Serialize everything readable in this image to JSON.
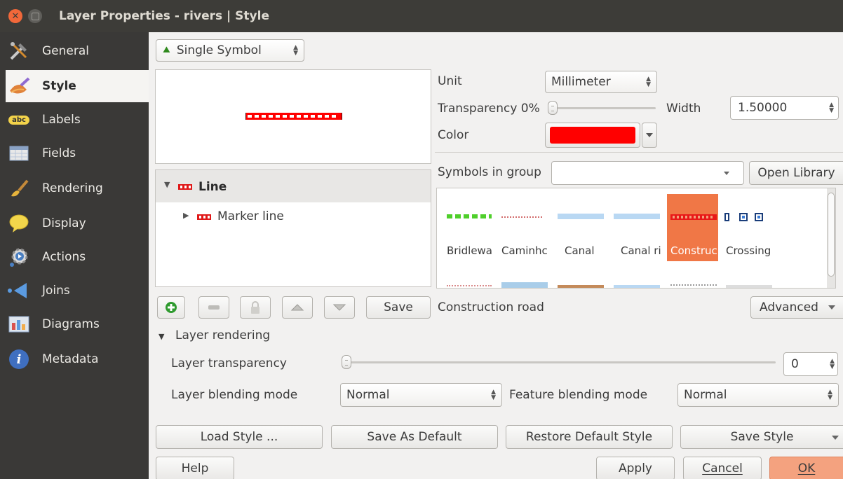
{
  "window": {
    "title": "Layer Properties - rivers | Style",
    "close_glyph": "✕"
  },
  "sidebar": {
    "items": [
      {
        "label": "General",
        "icon": "tools-icon"
      },
      {
        "label": "Style",
        "icon": "brush-icon"
      },
      {
        "label": "Labels",
        "icon": "abc-label-icon",
        "icon_text": "abc"
      },
      {
        "label": "Fields",
        "icon": "table-icon"
      },
      {
        "label": "Rendering",
        "icon": "paintbrush-icon"
      },
      {
        "label": "Display",
        "icon": "speech-bubble-icon"
      },
      {
        "label": "Actions",
        "icon": "gear-play-icon"
      },
      {
        "label": "Joins",
        "icon": "join-arrow-icon"
      },
      {
        "label": "Diagrams",
        "icon": "diagram-icon"
      },
      {
        "label": "Metadata",
        "icon": "info-icon",
        "icon_text": "i"
      }
    ],
    "active_index": 1
  },
  "renderer": {
    "type_value": "Single Symbol"
  },
  "symbol_tree": {
    "root_label": "Line",
    "child_label": "Marker line"
  },
  "symbol_props": {
    "unit_label": "Unit",
    "unit_value": "Millimeter",
    "transparency_label": "Transparency 0%",
    "width_label": "Width",
    "width_value": "1.50000",
    "color_label": "Color",
    "color_value": "#ff0000"
  },
  "symbols_group": {
    "label": "Symbols in group",
    "group_value": "",
    "open_library": "Open Library",
    "items": [
      {
        "name": "Bridlewa",
        "style": "green-dash"
      },
      {
        "name": "Caminhc",
        "style": "red-dots"
      },
      {
        "name": "Canal",
        "style": "light-blue"
      },
      {
        "name": "Canal ri",
        "style": "light-blue"
      },
      {
        "name": "Construc",
        "style": "construction",
        "selected": true
      },
      {
        "name": "Crossing",
        "style": "crossing"
      }
    ],
    "selected_name": "Construction road",
    "advanced": "Advanced"
  },
  "toolbar": {
    "save": "Save"
  },
  "layer_rendering": {
    "header": "Layer rendering",
    "transparency_label": "Layer transparency",
    "transparency_value": "0",
    "blend_label": "Layer blending mode",
    "blend_value": "Normal",
    "feature_blend_label": "Feature blending mode",
    "feature_blend_value": "Normal"
  },
  "style_buttons": {
    "load": "Load Style ...",
    "save_default": "Save As Default",
    "restore_default": "Restore Default Style",
    "save_style": "Save Style"
  },
  "dialog_buttons": {
    "help": "Help",
    "apply": "Apply",
    "cancel": "Cancel",
    "ok": "OK"
  },
  "colors": {
    "accent_selected": "#f07746",
    "ok_button": "#f4a27f",
    "sidebar_bg": "#3a3937",
    "title_bg": "#3d3c38"
  }
}
